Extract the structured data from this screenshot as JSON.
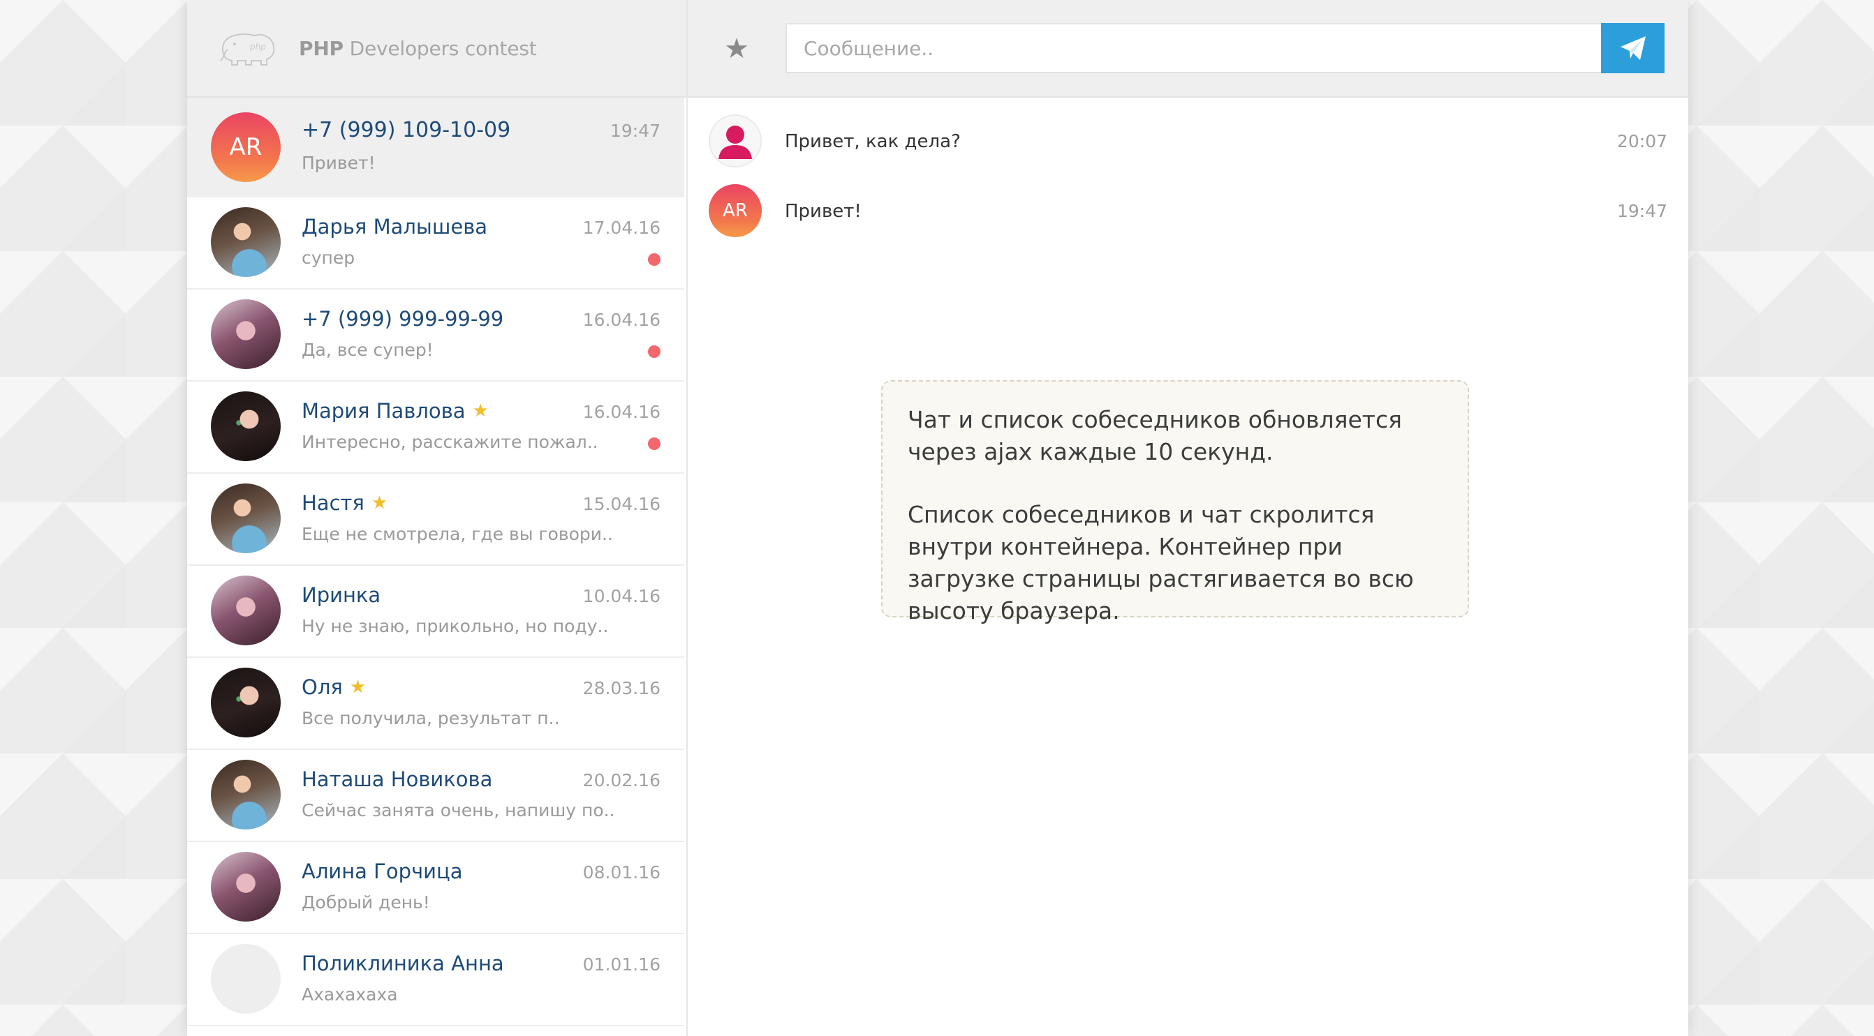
{
  "sidebar": {
    "brand_bold": "PHP",
    "brand_rest": " Developers contest",
    "contacts": [
      {
        "name": "+7 (999) 109-10-09",
        "time": "19:47",
        "preview": "Привет!",
        "avatar_text": "AR",
        "starred": false,
        "unread": false,
        "active": true
      },
      {
        "name": "Дарья Малышева",
        "time": "17.04.16",
        "preview": "супер",
        "starred": false,
        "unread": true
      },
      {
        "name": "+7 (999) 999-99-99",
        "time": "16.04.16",
        "preview": "Да, все супер!",
        "starred": false,
        "unread": true
      },
      {
        "name": "Мария Павлова",
        "time": "16.04.16",
        "preview": "Интересно, расскажите пожал..",
        "starred": true,
        "unread": true
      },
      {
        "name": "Настя",
        "time": "15.04.16",
        "preview": "Еще не смотрела, где вы говори..",
        "starred": true,
        "unread": false
      },
      {
        "name": "Иринка",
        "time": "10.04.16",
        "preview": "Ну не знаю, прикольно, но поду..",
        "starred": false,
        "unread": false
      },
      {
        "name": "Оля",
        "time": "28.03.16",
        "preview": "Все получила, результат п..",
        "starred": true,
        "unread": false
      },
      {
        "name": "Наташа Новикова",
        "time": "20.02.16",
        "preview": "Сейчас занята очень, напишу по..",
        "starred": false,
        "unread": false
      },
      {
        "name": "Алина Горчица",
        "time": "08.01.16",
        "preview": "Добрый день!",
        "starred": false,
        "unread": false
      },
      {
        "name": "Поликлиника Анна",
        "time": "01.01.16",
        "preview": "Ахахахаха",
        "starred": false,
        "unread": false
      }
    ]
  },
  "chat": {
    "input_placeholder": "Сообщение..",
    "messages": [
      {
        "text": "Привет, как дела?",
        "time": "20:07",
        "avatar": "user-icon"
      },
      {
        "text": "Привет!",
        "time": "19:47",
        "avatar_text": "AR"
      }
    ],
    "info": {
      "paragraph1": "Чат и список собеседников обновляется через ajax каждые 10 секунд.",
      "paragraph2": "Список собеседников и чат скролится внутри контейнера. Контейнер при загрузке страницы растягивается во всю высоту браузера."
    }
  },
  "colors": {
    "accent": "#2c9fda",
    "name": "#1e4b78",
    "unread": "#f1676b",
    "star": "#f1be2a"
  }
}
